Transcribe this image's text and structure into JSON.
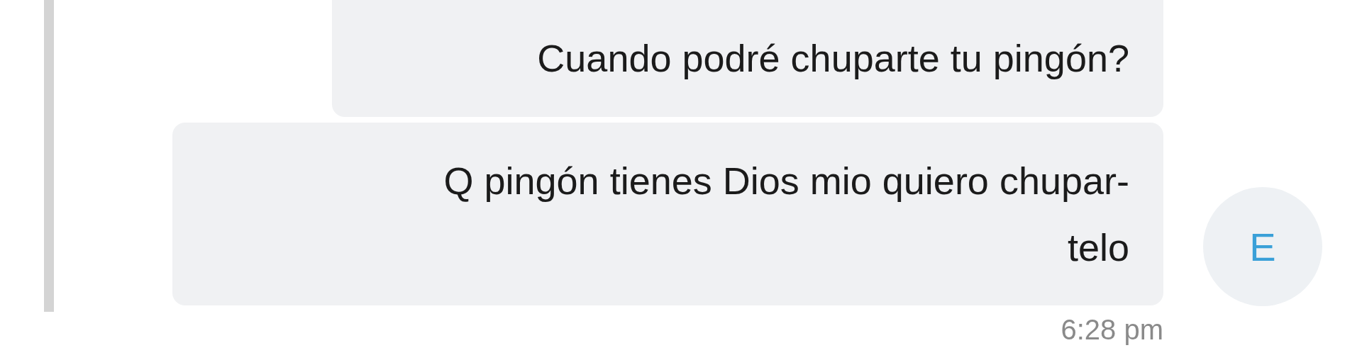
{
  "messages": [
    {
      "lines": [
        "Cuando podré chuparte tu pingón?"
      ]
    },
    {
      "lines": [
        "Q pingón tienes Dios mio quiero chupar-",
        "telo"
      ]
    }
  ],
  "avatar": {
    "letter": "E"
  },
  "time": "6:28 pm"
}
